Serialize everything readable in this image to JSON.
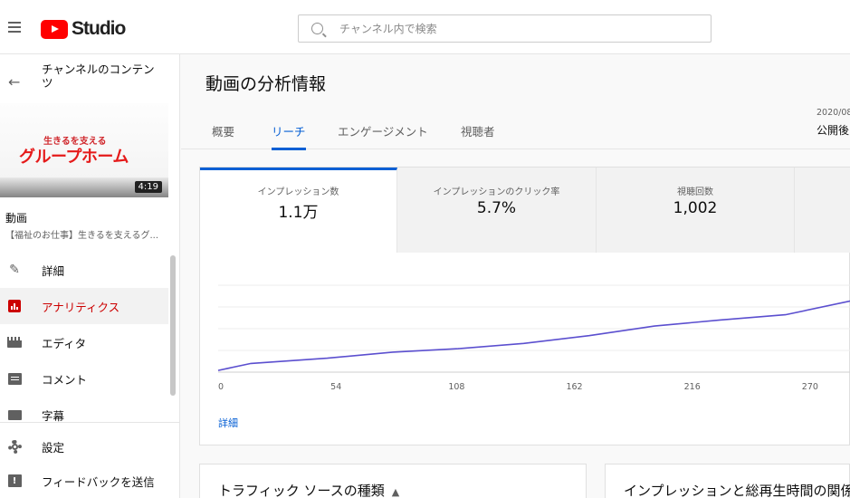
{
  "header": {
    "logo_text": "Studio",
    "search_placeholder": "チャンネル内で検索"
  },
  "sidebar": {
    "back_label": "チャンネルのコンテンツ",
    "thumbnail": {
      "subtitle": "生きるを支える",
      "title": "グループホーム",
      "duration": "4:19"
    },
    "video_label": "動画",
    "video_title": "【福祉のお仕事】生きるを支えるグ...",
    "nav": [
      {
        "label": "詳細",
        "icon": "pencil-icon"
      },
      {
        "label": "アナリティクス",
        "icon": "analytics-icon",
        "active": true
      },
      {
        "label": "エディタ",
        "icon": "editor-icon"
      },
      {
        "label": "コメント",
        "icon": "comment-icon"
      },
      {
        "label": "字幕",
        "icon": "subtitles-icon"
      }
    ],
    "bottom": [
      {
        "label": "設定",
        "icon": "gear-icon"
      },
      {
        "label": "フィードバックを送信",
        "icon": "feedback-icon"
      }
    ]
  },
  "main": {
    "title": "動画の分析情報",
    "date_top": "2020/08",
    "date_bottom": "公開後",
    "tabs": [
      {
        "label": "概要"
      },
      {
        "label": "リーチ",
        "active": true
      },
      {
        "label": "エンゲージメント"
      },
      {
        "label": "視聴者"
      }
    ],
    "metrics": [
      {
        "label": "インプレッション数",
        "value": "1.1万",
        "active": true
      },
      {
        "label": "インプレッションのクリック率",
        "value": "5.7%"
      },
      {
        "label": "視聴回数",
        "value": "1,002"
      }
    ],
    "detail_link": "詳細",
    "panels": [
      {
        "title": "トラフィック ソースの種類"
      },
      {
        "title": "インプレッションと総再生時間の関係"
      }
    ]
  },
  "colors": {
    "accent": "#065fd4",
    "brand_red": "#ff0000",
    "active_nav": "#cc0000",
    "line": "#5b4fcf"
  },
  "chart_data": {
    "type": "line",
    "x_ticks": [
      0,
      54,
      108,
      162,
      216,
      270
    ],
    "xlim": [
      0,
      290
    ],
    "series": [
      {
        "x": [
          0,
          15,
          50,
          80,
          110,
          140,
          170,
          200,
          230,
          260,
          290
        ],
        "y": [
          0.02,
          0.1,
          0.16,
          0.23,
          0.27,
          0.33,
          0.42,
          0.53,
          0.6,
          0.66,
          0.82
        ]
      }
    ],
    "ylim": [
      0,
      1
    ],
    "grid": true,
    "legend": "none"
  }
}
